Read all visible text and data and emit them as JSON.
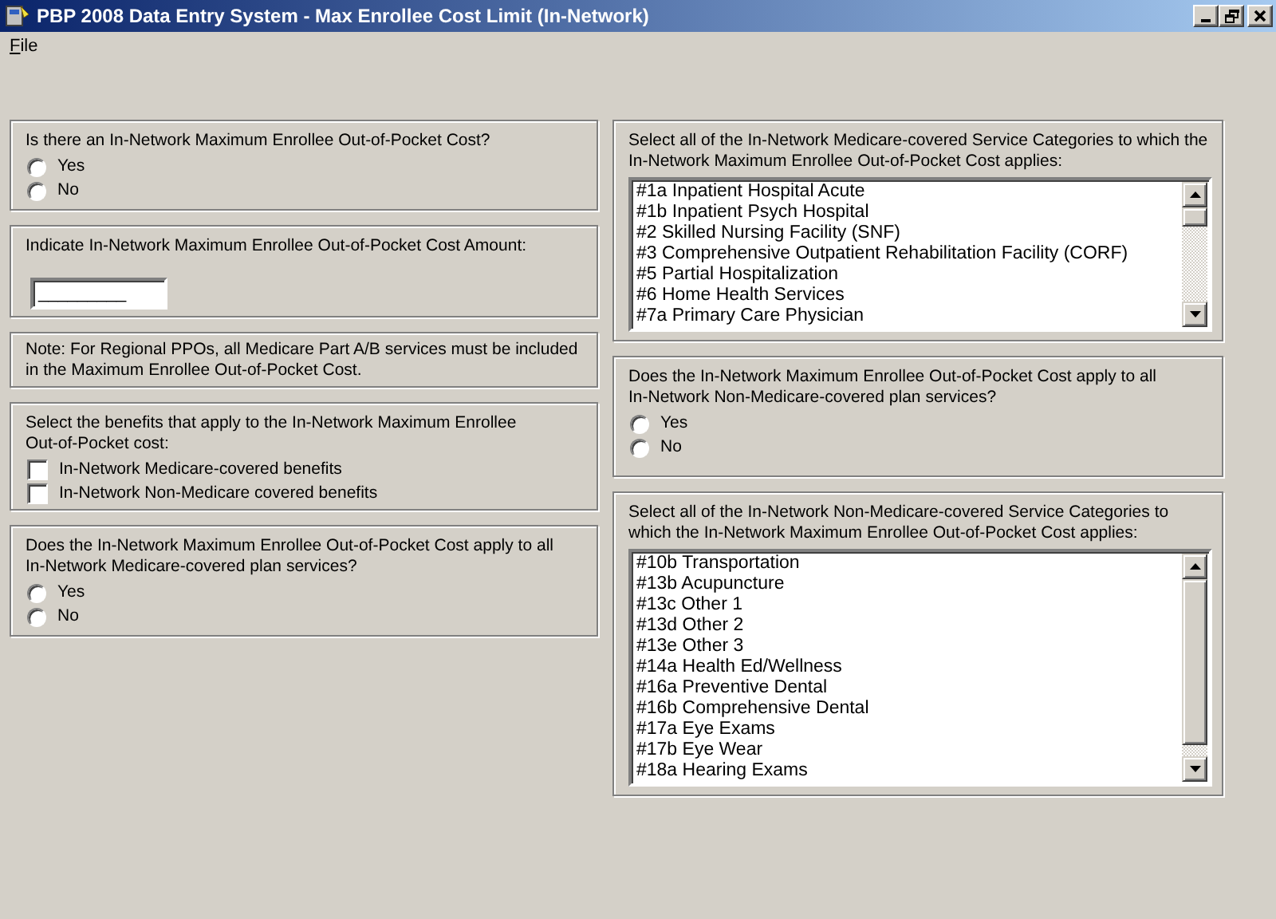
{
  "window": {
    "title": "PBP 2008 Data Entry System - Max Enrollee Cost Limit (In-Network)"
  },
  "menu": [
    {
      "label": "File"
    }
  ],
  "left_panels": [
    {
      "kind": "radio",
      "question": "Is there an In-Network Maximum Enrollee Out-of-Pocket Cost?",
      "options": [
        {
          "label": "Yes",
          "selected": false
        },
        {
          "label": "No",
          "selected": false
        }
      ]
    },
    {
      "kind": "amount",
      "question": "Indicate In-Network Maximum Enrollee Out-of-Pocket Cost Amount:",
      "value": "_________"
    },
    {
      "kind": "note",
      "question": "Note: For Regional PPOs, all Medicare Part A/B services must be included in the Maximum Enrollee Out-of-Pocket Cost."
    },
    {
      "kind": "checkbox",
      "question": "Select the benefits that apply to the In-Network Maximum Enrollee Out-of-Pocket cost:",
      "options": [
        {
          "label": "In-Network Medicare-covered benefits",
          "checked": false
        },
        {
          "label": "In-Network Non-Medicare covered benefits",
          "checked": false
        }
      ]
    },
    {
      "kind": "radio",
      "question": "Does the In-Network Maximum Enrollee Out-of-Pocket Cost apply to all In-Network Medicare-covered plan services?",
      "options": [
        {
          "label": "Yes",
          "selected": false
        },
        {
          "label": "No",
          "selected": false
        }
      ]
    }
  ],
  "right_panels": [
    {
      "kind": "list",
      "question": "Select all of the In-Network Medicare-covered Service Categories to which the In-Network Maximum Enrollee Out-of-Pocket Cost applies:",
      "items": [
        {
          "label": "#1a Inpatient Hospital Acute",
          "selected": false
        },
        {
          "label": "#1b Inpatient Psych Hospital",
          "selected": false
        },
        {
          "label": "#2 Skilled Nursing Facility (SNF)",
          "selected": false
        },
        {
          "label": "#3 Comprehensive Outpatient Rehabilitation Facility (CORF)",
          "selected": false
        },
        {
          "label": "#5 Partial Hospitalization",
          "selected": false
        },
        {
          "label": "#6 Home Health Services",
          "selected": false
        },
        {
          "label": "#7a Primary Care Physician",
          "selected": false
        }
      ]
    },
    {
      "kind": "radio",
      "question": "Does the In-Network Maximum Enrollee Out-of-Pocket Cost apply to all In-Network Non-Medicare-covered plan services?",
      "options": [
        {
          "label": "Yes",
          "selected": false
        },
        {
          "label": "No",
          "selected": false
        }
      ]
    },
    {
      "kind": "list",
      "question": "Select all of the In-Network Non-Medicare-covered Service Categories to which the In-Network Maximum Enrollee Out-of-Pocket Cost applies:",
      "items": [
        {
          "label": "#10b Transportation",
          "selected": false
        },
        {
          "label": "#13b Acupuncture",
          "selected": false
        },
        {
          "label": "#13c Other 1",
          "selected": false
        },
        {
          "label": "#13d Other 2",
          "selected": false
        },
        {
          "label": "#13e Other 3",
          "selected": false
        },
        {
          "label": "#14a Health Ed/Wellness",
          "selected": false
        },
        {
          "label": "#16a Preventive Dental",
          "selected": false
        },
        {
          "label": "#16b Comprehensive Dental",
          "selected": false
        },
        {
          "label": "#17a Eye Exams",
          "selected": false
        },
        {
          "label": "#17b Eye Wear",
          "selected": false
        },
        {
          "label": "#18a Hearing Exams",
          "selected": false
        }
      ]
    }
  ]
}
